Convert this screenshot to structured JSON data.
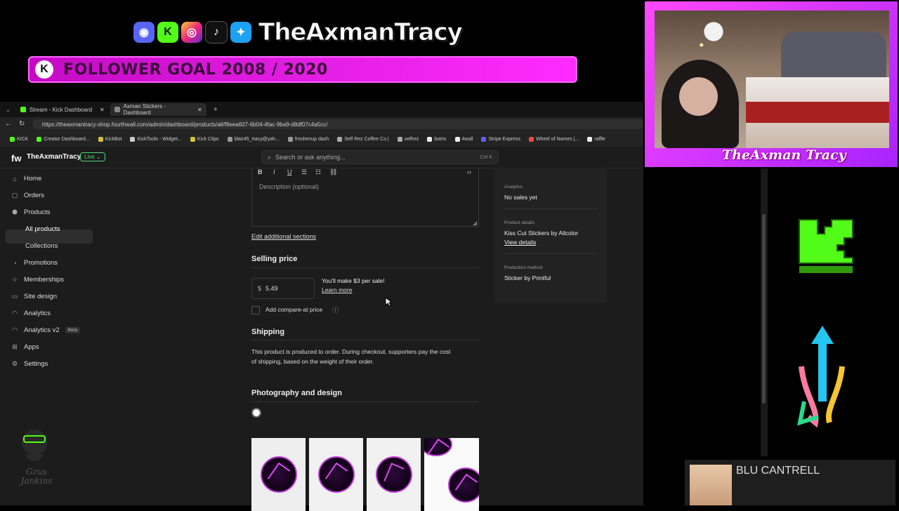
{
  "overlay": {
    "brand_title": "TheAxmanTracy",
    "social_icons": [
      "discord-icon",
      "kick-icon",
      "instagram-icon",
      "tiktok-icon",
      "twitter-icon"
    ],
    "goal_badge": "K",
    "goal_text": "FOLLOWER GOAL 2008 / 2020",
    "cam_name": "TheAxman Tracy",
    "blu_name": "BLU CANTRELL",
    "gzus_text": "Gzus Jankins",
    "colors": {
      "goal_pink": "#e51fe5",
      "frame_purple": "#a823ff",
      "kick_green": "#53fc18"
    }
  },
  "browser": {
    "tabs": [
      {
        "label": "Stream - Kick Dashboard"
      },
      {
        "label": "Axman Stickers - Dashboard"
      }
    ],
    "url": "https://theaxmantracy-shop.fourthwall.com/admin/dashboard/products/all/f8eea607-6b04-4fac-9ba9-d8df07c4a5cc/",
    "bookmarks": [
      "KICK",
      "Creator Dashboard...",
      "KickBot",
      "KickTools - Widget...",
      "Kick Clips",
      "blair45_tracy@yah...",
      "freshenup dash",
      "Self Rez Coffee Co.|",
      "selfrez",
      "botrix",
      "4wall",
      "Stripe Express",
      "Wheel of Names |...",
      "raffle"
    ]
  },
  "app": {
    "logo": "fw",
    "store_name": "TheAxmanTracy",
    "live_label": "Live ⌄",
    "search_placeholder": "Search or ask anything...",
    "search_shortcut": "Ctrl K",
    "nav": [
      {
        "label": "Home",
        "icon": "home-icon"
      },
      {
        "label": "Orders",
        "icon": "orders-icon"
      },
      {
        "label": "Products",
        "icon": "products-icon"
      },
      {
        "label": "All products"
      },
      {
        "label": "Collections"
      },
      {
        "label": "Promotions",
        "icon": "promotions-icon"
      },
      {
        "label": "Memberships",
        "icon": "memberships-icon"
      },
      {
        "label": "Site design",
        "icon": "site-design-icon"
      },
      {
        "label": "Analytics",
        "icon": "analytics-icon"
      },
      {
        "label": "Analytics v2",
        "icon": "analytics-v2-icon",
        "badge": "Beta"
      },
      {
        "label": "Apps",
        "icon": "apps-icon"
      },
      {
        "label": "Settings",
        "icon": "settings-icon"
      }
    ],
    "editor": {
      "toolbar": [
        "B",
        "I",
        "U"
      ],
      "description_placeholder": "Description (optional)",
      "edit_sections_link": "Edit additional sections"
    },
    "selling_price": {
      "heading": "Selling price",
      "currency": "$",
      "price": "5.49",
      "make_text": "You'll make $3 per sale!",
      "learn_more": "Learn more",
      "compare_label": "Add compare-at price"
    },
    "shipping": {
      "heading": "Shipping",
      "text_line1": "This product is produced to order. During checkout, supporters pay the cost",
      "text_line2": "of shipping, based on the weight of their order."
    },
    "photography": {
      "heading": "Photography and design"
    },
    "right_panel": {
      "analytics_label": "Analytics",
      "analytics_value": "No sales yet",
      "product_details_label": "Product details",
      "product_details_value": "Kiss Cut Stickers by Allcolor",
      "view_details": "View details",
      "production_label": "Production method",
      "production_value": "Sticker by Printful"
    }
  }
}
